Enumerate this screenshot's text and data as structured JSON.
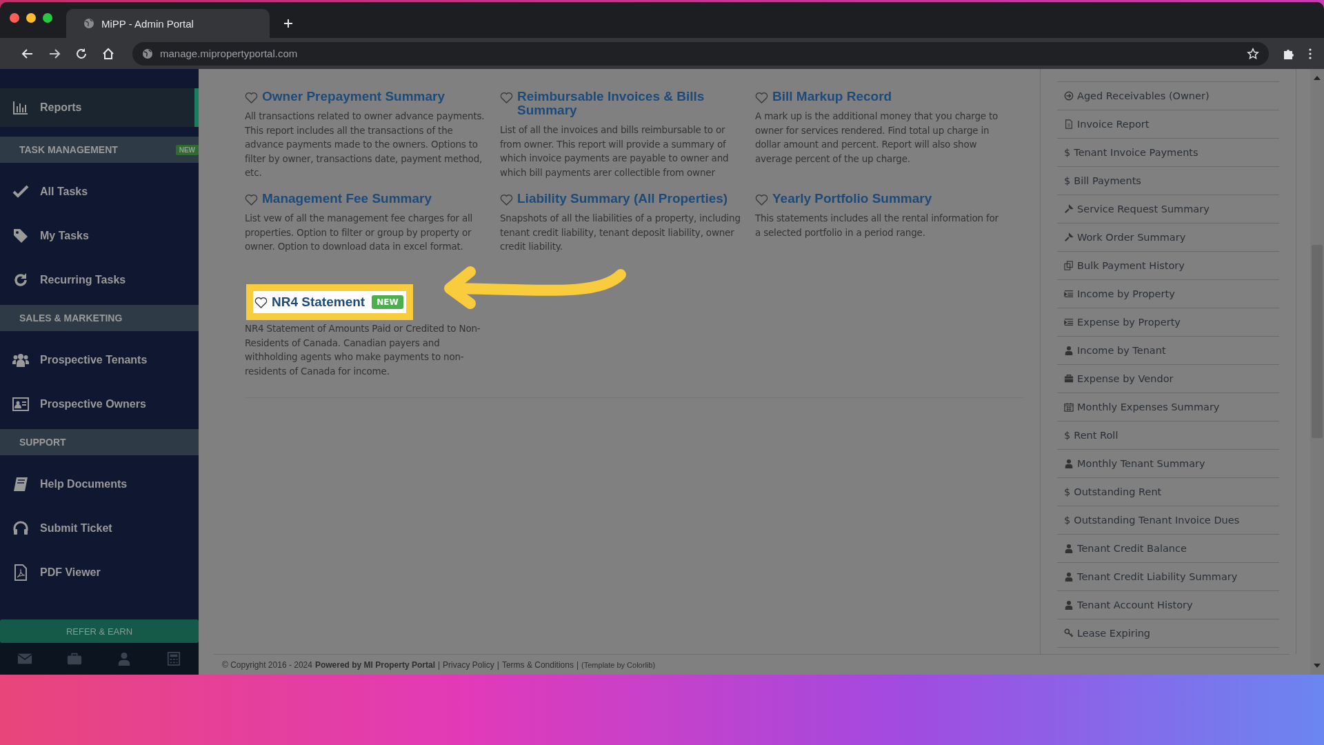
{
  "browser": {
    "tab_title": "MiPP - Admin Portal",
    "url": "manage.mipropertyportal.com"
  },
  "sidebar": {
    "items": [
      {
        "kind": "item",
        "label": "Reports",
        "selected": true
      },
      {
        "kind": "header",
        "label": "TASK MANAGEMENT",
        "badge": "NEW"
      },
      {
        "kind": "item",
        "label": "All Tasks",
        "selected": false
      },
      {
        "kind": "item",
        "label": "My Tasks",
        "selected": false
      },
      {
        "kind": "item",
        "label": "Recurring Tasks",
        "selected": false
      },
      {
        "kind": "header",
        "label": "SALES & MARKETING"
      },
      {
        "kind": "item",
        "label": "Prospective Tenants",
        "selected": false
      },
      {
        "kind": "item",
        "label": "Prospective Owners",
        "selected": false
      },
      {
        "kind": "header",
        "label": "SUPPORT"
      },
      {
        "kind": "item",
        "label": "Help Documents",
        "selected": false
      },
      {
        "kind": "item",
        "label": "Submit Ticket",
        "selected": false
      },
      {
        "kind": "item",
        "label": "PDF Viewer",
        "selected": false
      }
    ],
    "refer_button": "REFER & EARN"
  },
  "reports": [
    {
      "title": "Owner Prepayment Summary",
      "description": "All transactions related to owner advance payments. This report includes all the transactions of the advance payments made to the owners. Options to filter by owner, transactions date, payment method, etc.",
      "highlighted": false
    },
    {
      "title": "Reimbursable Invoices & Bills Summary",
      "description": "List of all the invoices and bills reimbursable to or from owner. This report will provide a summary of which invoice payments are payable to owner and which bill payments arer collectible from owner",
      "highlighted": false
    },
    {
      "title": "Bill Markup Record",
      "description": "A mark up is the additional money that you charge to owner for services rendered. Find total up charge in dollar amount and percent. Report will also show average percent of the up charge.",
      "highlighted": false
    },
    {
      "title": "Management Fee Summary",
      "description": "List vew of all the management fee charges for all properties. Option to filter or group by property or owner. Option to download data in excel format.",
      "highlighted": false
    },
    {
      "title": "Liability Summary (All Properties)",
      "description": "Snapshots of all the liabilities of a property, including tenant credit liability, tenant deposit liability, owner credit liability.",
      "highlighted": false
    },
    {
      "title": "Yearly Portfolio Summary",
      "description": "This statements includes all the rental information for a selected portfolio in a period range.",
      "highlighted": false
    },
    {
      "title": "NR4 Statement",
      "badge": "NEW",
      "description": "NR4 Statement of Amounts Paid or Credited to Non-Residents of Canada. Canadian payers and withholding agents who make payments to non-residents of Canada for income.",
      "highlighted": true
    }
  ],
  "report_links": [
    {
      "label": "Aged Receivables (Owner)"
    },
    {
      "label": "Invoice Report"
    },
    {
      "symbol": "$",
      "label": "Tenant Invoice Payments"
    },
    {
      "symbol": "$",
      "label": "Bill Payments"
    },
    {
      "label": "Service Request Summary"
    },
    {
      "label": "Work Order Summary"
    },
    {
      "label": "Bulk Payment History"
    },
    {
      "label": "Income by Property"
    },
    {
      "label": "Expense by Property"
    },
    {
      "label": "Income by Tenant"
    },
    {
      "label": "Expense by Vendor"
    },
    {
      "label": "Monthly Expenses Summary"
    },
    {
      "symbol": "$",
      "label": "Rent Roll"
    },
    {
      "label": "Monthly Tenant Summary"
    },
    {
      "symbol": "$",
      "label": "Outstanding Rent"
    },
    {
      "symbol": "$",
      "label": "Outstanding Tenant Invoice Dues"
    },
    {
      "label": "Tenant Credit Balance"
    },
    {
      "label": "Tenant Credit Liability Summary"
    },
    {
      "label": "Tenant Account History"
    },
    {
      "label": "Lease Expiring"
    }
  ],
  "footer": [
    {
      "kind": "text",
      "text": "© Copyright 2016 - 2024"
    },
    {
      "kind": "bold",
      "text": "Powered by MI Property Portal"
    },
    {
      "kind": "separator",
      "text": "|"
    },
    {
      "kind": "link",
      "text": "Privacy Policy"
    },
    {
      "kind": "separator",
      "text": "|"
    },
    {
      "kind": "link",
      "text": "Terms & Conditions"
    },
    {
      "kind": "separator",
      "text": "|"
    },
    {
      "kind": "small",
      "text": "(Template by Colorlib)"
    }
  ]
}
